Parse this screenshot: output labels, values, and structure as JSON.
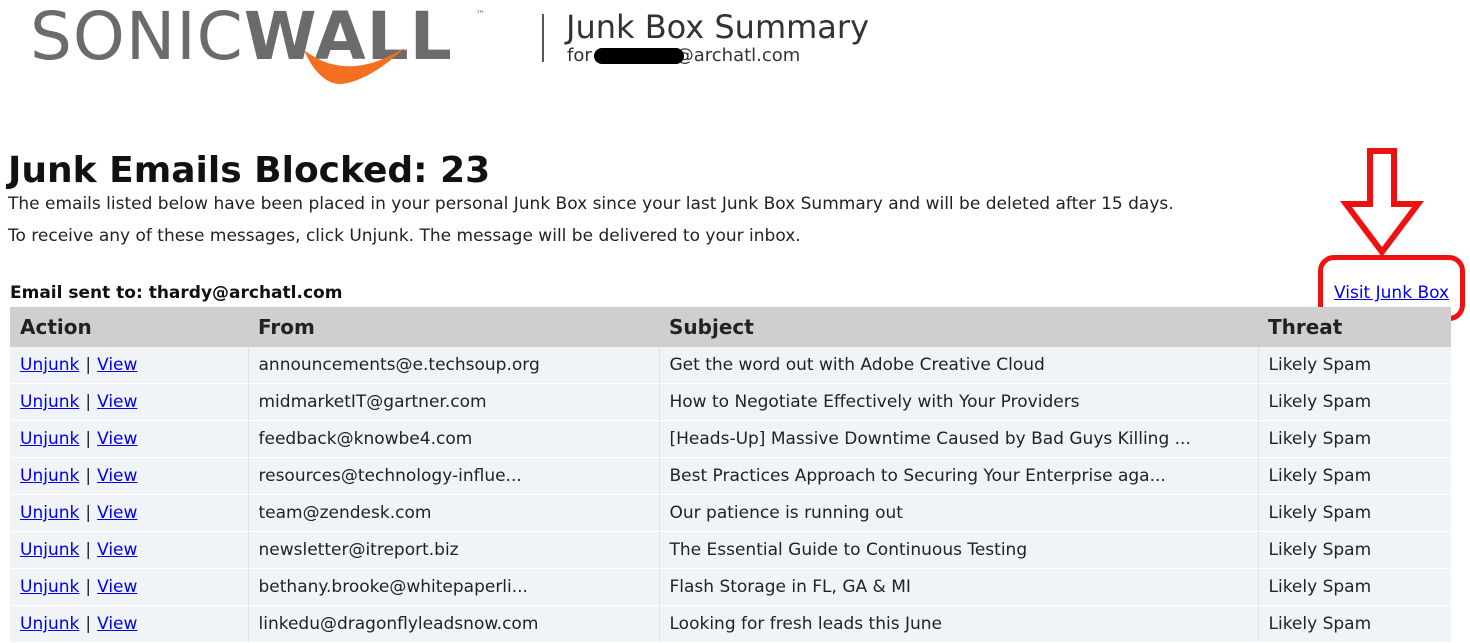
{
  "brand": {
    "logo_part1": "SONIC",
    "logo_part2": "WALL",
    "tm": "™"
  },
  "header": {
    "title": "Junk Box Summary",
    "recipient_prefix": "for",
    "recipient_suffix": "@archatl.com"
  },
  "summary": {
    "headline": "Junk Emails Blocked: 23",
    "line1": "The emails listed below have been placed in your personal Junk Box since your last Junk Box Summary and will be deleted after 15 days.",
    "line2": "To receive any of these messages, click Unjunk. The message will be delivered to your inbox.",
    "sent_to": "Email sent to: thardy@archatl.com",
    "visit_link": "Visit Junk Box"
  },
  "table": {
    "columns": [
      "Action",
      "From",
      "Subject",
      "Threat"
    ],
    "action_unjunk": "Unjunk",
    "action_separator": "|",
    "action_view": "View",
    "rows": [
      {
        "from": "announcements@e.techsoup.org",
        "subject": "Get the word out with Adobe Creative Cloud",
        "threat": "Likely Spam"
      },
      {
        "from": "midmarketIT@gartner.com",
        "subject": "How to Negotiate Effectively with Your Providers",
        "threat": "Likely Spam"
      },
      {
        "from": "feedback@knowbe4.com",
        "subject": "[Heads-Up] Massive Downtime Caused by Bad Guys Killing ...",
        "threat": "Likely Spam"
      },
      {
        "from": "resources@technology-influe...",
        "subject": "Best Practices Approach to Securing Your Enterprise aga...",
        "threat": "Likely Spam"
      },
      {
        "from": "team@zendesk.com",
        "subject": "Our patience is running out",
        "threat": "Likely Spam"
      },
      {
        "from": "newsletter@itreport.biz",
        "subject": "The Essential Guide to Continuous Testing",
        "threat": "Likely Spam"
      },
      {
        "from": "bethany.brooke@whitepaperli...",
        "subject": "Flash Storage in FL, GA & MI",
        "threat": "Likely Spam"
      },
      {
        "from": "linkedu@dragonflyleadsnow.com",
        "subject": "Looking for fresh leads this June",
        "threat": "Likely Spam"
      }
    ]
  },
  "annotation": {
    "arrow_color": "#ee1111",
    "icon": "down-arrow-icon"
  },
  "colors": {
    "link": "#0000ee",
    "header_bg": "#cfcfcf",
    "row_bg": "#f1f4f7",
    "brand_orange": "#f37021",
    "logo_gray": "#6b6b6b"
  }
}
